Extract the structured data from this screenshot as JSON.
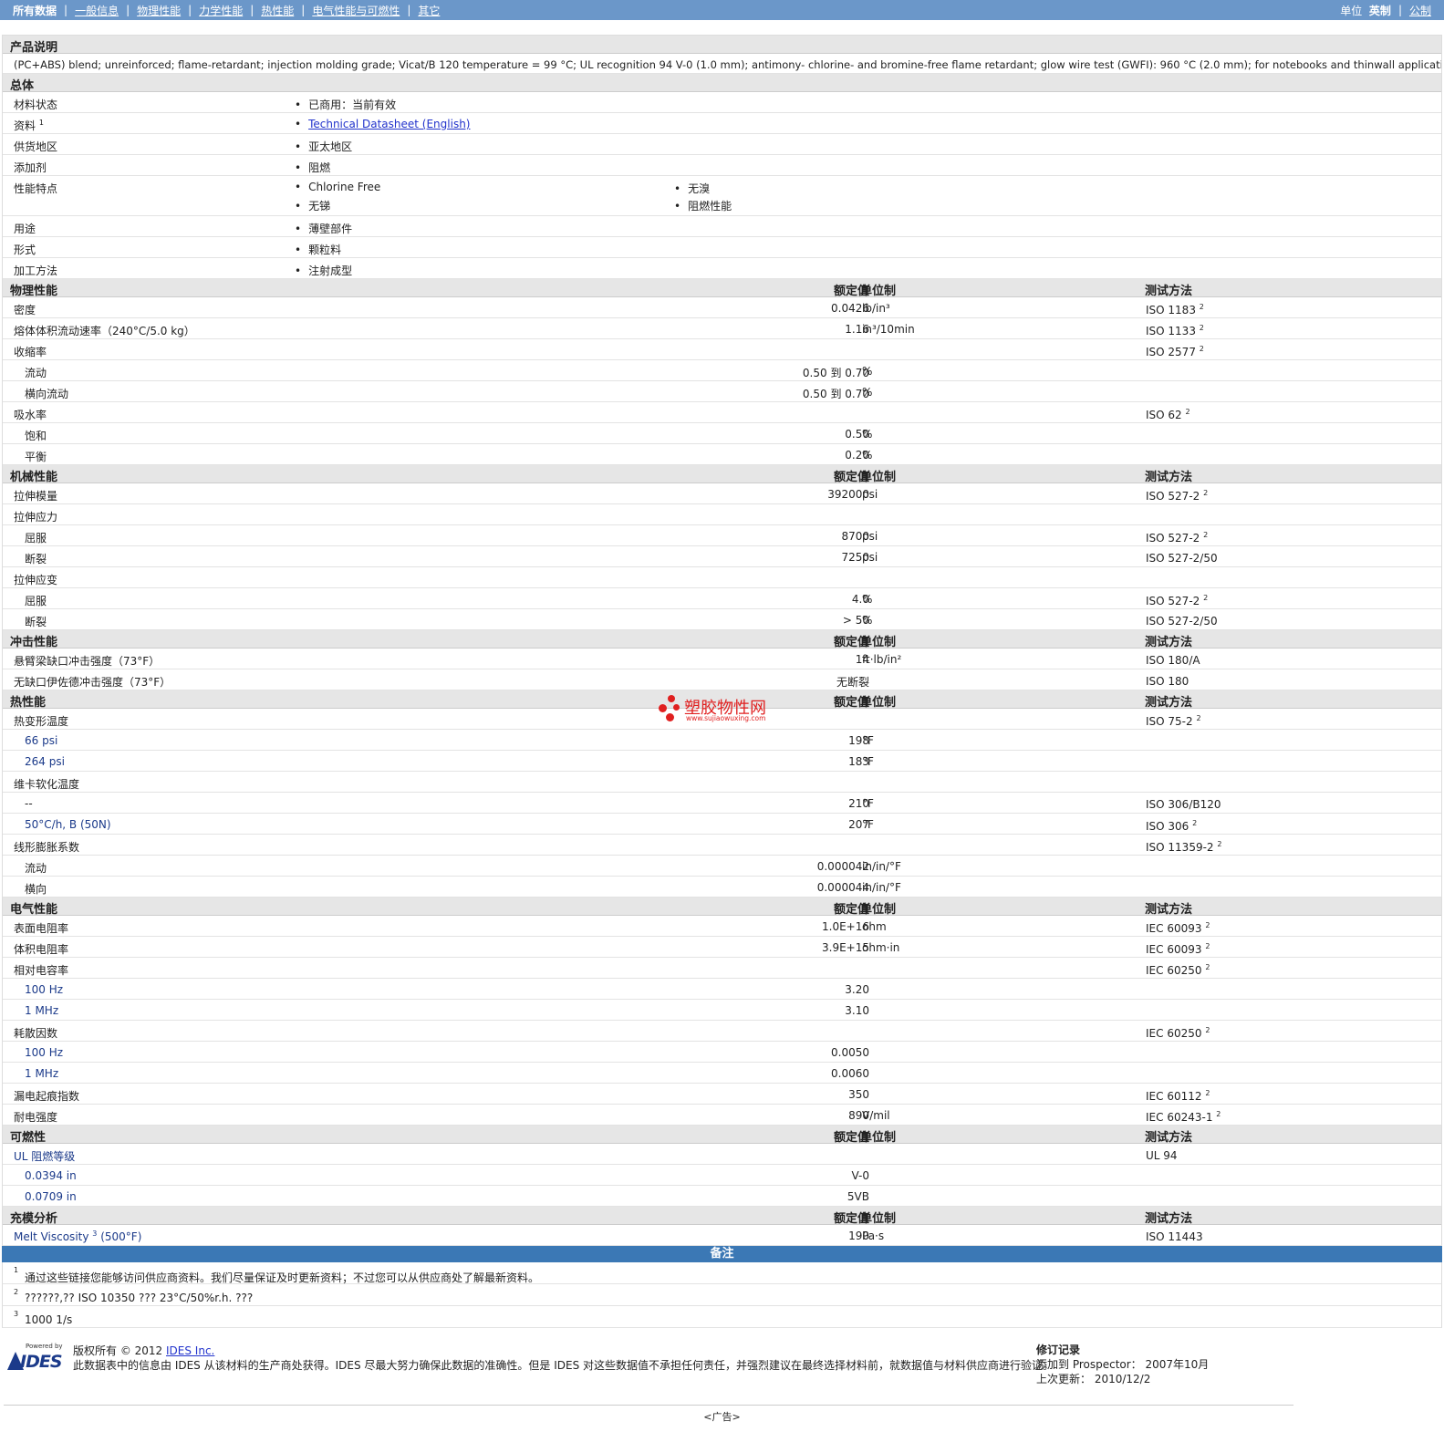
{
  "nav": {
    "items": [
      "所有数据",
      "一般信息",
      "物理性能",
      "力学性能",
      "热性能",
      "电气性能与可燃性",
      "其它"
    ],
    "sep": "|",
    "unit_label": "单位",
    "unit_english": "英制",
    "unit_metric": "公制"
  },
  "product": {
    "heading": "产品说明",
    "description": "(PC+ABS) blend; unreinforced; flame-retardant; injection molding grade; Vicat/B 120 temperature = 99 °C; UL recognition 94 V-0 (1.0 mm); antimony- chlorine- and bromine-free flame retardant; glow wire test (GWFI): 960 °C (2.0 mm); for notebooks and thinwall applications."
  },
  "general": {
    "heading": "总体",
    "status_label": "材料状态",
    "status_value": "已商用：当前有效",
    "docs_label": "资料",
    "docs_sup": "1",
    "docs_value": "Technical Datasheet (English)",
    "region_label": "供货地区",
    "region_value": "亚太地区",
    "additive_label": "添加剂",
    "additive_value": "阻燃",
    "features_label": "性能特点",
    "features": [
      "Chlorine Free",
      "无溴",
      "无锑",
      "阻燃性能"
    ],
    "use_label": "用途",
    "use_value": "薄壁部件",
    "form_label": "形式",
    "form_value": "颗粒料",
    "process_label": "加工方法",
    "process_value": "注射成型"
  },
  "headers": {
    "value": "额定值",
    "unit": "单位制",
    "method": "测试方法"
  },
  "physical": {
    "heading": "物理性能",
    "density": {
      "label": "密度",
      "value": "0.0426",
      "unit": "lb/in³",
      "method": "ISO 1183",
      "sup": "2"
    },
    "mvr": {
      "label": "熔体体积流动速率（240°C/5.0 kg）",
      "value": "1.16",
      "unit": "in³/10min",
      "method": "ISO 1133",
      "sup": "2"
    },
    "shrink": {
      "label": "收缩率",
      "method": "ISO 2577",
      "sup": "2"
    },
    "shrink_flow": {
      "label": "流动",
      "value": "0.50 到 0.70",
      "unit": "%"
    },
    "shrink_trans": {
      "label": "横向流动",
      "value": "0.50 到 0.70",
      "unit": "%"
    },
    "water": {
      "label": "吸水率",
      "method": "ISO 62",
      "sup": "2"
    },
    "water_sat": {
      "label": "饱和",
      "value": "0.50",
      "unit": "%"
    },
    "water_eq": {
      "label": "平衡",
      "value": "0.20",
      "unit": "%"
    }
  },
  "mechanical": {
    "heading": "机械性能",
    "modulus": {
      "label": "拉伸模量",
      "value": "392000",
      "unit": "psi",
      "method": "ISO 527-2",
      "sup": "2"
    },
    "stress": {
      "label": "拉伸应力"
    },
    "stress_yield": {
      "label": "屈服",
      "value": "8700",
      "unit": "psi",
      "method": "ISO 527-2",
      "sup": "2"
    },
    "stress_break": {
      "label": "断裂",
      "value": "7250",
      "unit": "psi",
      "method": "ISO 527-2/50"
    },
    "strain": {
      "label": "拉伸应变"
    },
    "strain_yield": {
      "label": "屈服",
      "value": "4.0",
      "unit": "%",
      "method": "ISO 527-2",
      "sup": "2"
    },
    "strain_break": {
      "label": "断裂",
      "value": "> 50",
      "unit": "%",
      "method": "ISO 527-2/50"
    }
  },
  "impact": {
    "heading": "冲击性能",
    "notched": {
      "label": "悬臂梁缺口冲击强度（73°F）",
      "value": "14",
      "unit": "ft·lb/in²",
      "method": "ISO 180/A"
    },
    "unnotched": {
      "label": "无缺口伊佐德冲击强度（73°F）",
      "value": "无断裂",
      "method": "ISO 180"
    }
  },
  "thermal": {
    "heading": "热性能",
    "hdt": {
      "label": "热变形温度",
      "method": "ISO 75-2",
      "sup": "2"
    },
    "hdt66": {
      "label": "66 psi",
      "value": "198",
      "unit": "°F"
    },
    "hdt264": {
      "label": "264 psi",
      "value": "183",
      "unit": "°F"
    },
    "vicat": {
      "label": "维卡软化温度"
    },
    "vicat1": {
      "label": "--",
      "value": "210",
      "unit": "°F",
      "method": "ISO 306/B120"
    },
    "vicat2": {
      "label": "50°C/h, B (50N)",
      "value": "207",
      "unit": "°F",
      "method": "ISO 306",
      "sup": "2"
    },
    "clte": {
      "label": "线形膨胀系数",
      "method": "ISO 11359-2",
      "sup": "2"
    },
    "clte_flow": {
      "label": "流动",
      "value": "0.000042",
      "unit": "in/in/°F"
    },
    "clte_trans": {
      "label": "横向",
      "value": "0.000044",
      "unit": "in/in/°F"
    }
  },
  "electrical": {
    "heading": "电气性能",
    "surface": {
      "label": "表面电阻率",
      "value": "1.0E+16",
      "unit": "ohm",
      "method": "IEC 60093",
      "sup": "2"
    },
    "volume": {
      "label": "体积电阻率",
      "value": "3.9E+15",
      "unit": "ohm·in",
      "method": "IEC 60093",
      "sup": "2"
    },
    "permit": {
      "label": "相对电容率",
      "method": "IEC 60250",
      "sup": "2"
    },
    "permit100": {
      "label": "100 Hz",
      "value": "3.20"
    },
    "permit1m": {
      "label": "1 MHz",
      "value": "3.10"
    },
    "dissip": {
      "label": "耗散因数",
      "method": "IEC 60250",
      "sup": "2"
    },
    "dissip100": {
      "label": "100 Hz",
      "value": "0.0050"
    },
    "dissip1m": {
      "label": "1 MHz",
      "value": "0.0060"
    },
    "cti": {
      "label": "漏电起痕指数",
      "value": "350",
      "method": "IEC 60112",
      "sup": "2"
    },
    "strength": {
      "label": "耐电强度",
      "value": "890",
      "unit": "V/mil",
      "method": "IEC 60243-1",
      "sup": "2"
    }
  },
  "flammability": {
    "heading": "可燃性",
    "ul": {
      "label": "UL 阻燃等级",
      "method": "UL 94"
    },
    "ul1": {
      "label": "0.0394 in",
      "value": "V-0"
    },
    "ul2": {
      "label": "0.0709 in",
      "value": "5VB"
    }
  },
  "filling": {
    "heading": "充模分析",
    "melt": {
      "label": "Melt Viscosity",
      "sup": "3",
      "cond": "(500°F)",
      "value": "190",
      "unit": "Pa·s",
      "method": "ISO 11443"
    }
  },
  "notes": {
    "heading": "备注",
    "items": [
      {
        "num": "1",
        "text": "通过这些链接您能够访问供应商资料。我们尽量保证及时更新资料；不过您可以从供应商处了解最新资料。"
      },
      {
        "num": "2",
        "text": "??????,?? ISO 10350 ??? 23°C/50%r.h. ???"
      },
      {
        "num": "3",
        "text": "1000 1/s"
      }
    ]
  },
  "footer": {
    "logo_powered": "Powered by",
    "logo_text": "IDES",
    "copyright": "版权所有 © 2012",
    "company": "IDES Inc.",
    "disclaimer": "此数据表中的信息由 IDES 从该材料的生产商处获得。IDES 尽最大努力确保此数据的准确性。但是 IDES 对这些数据值不承担任何责任，并强烈建议在最终选择材料前，就数据值与材料供应商进行验证。",
    "rev_title": "修订记录",
    "rev_added": "添加到 Prospector： 2007年10月",
    "rev_updated": "上次更新： 2010/12/2",
    "ad": "<广告>"
  },
  "watermark": {
    "text": "塑胶物性网",
    "url": "www.sujiaowuxing.com"
  }
}
